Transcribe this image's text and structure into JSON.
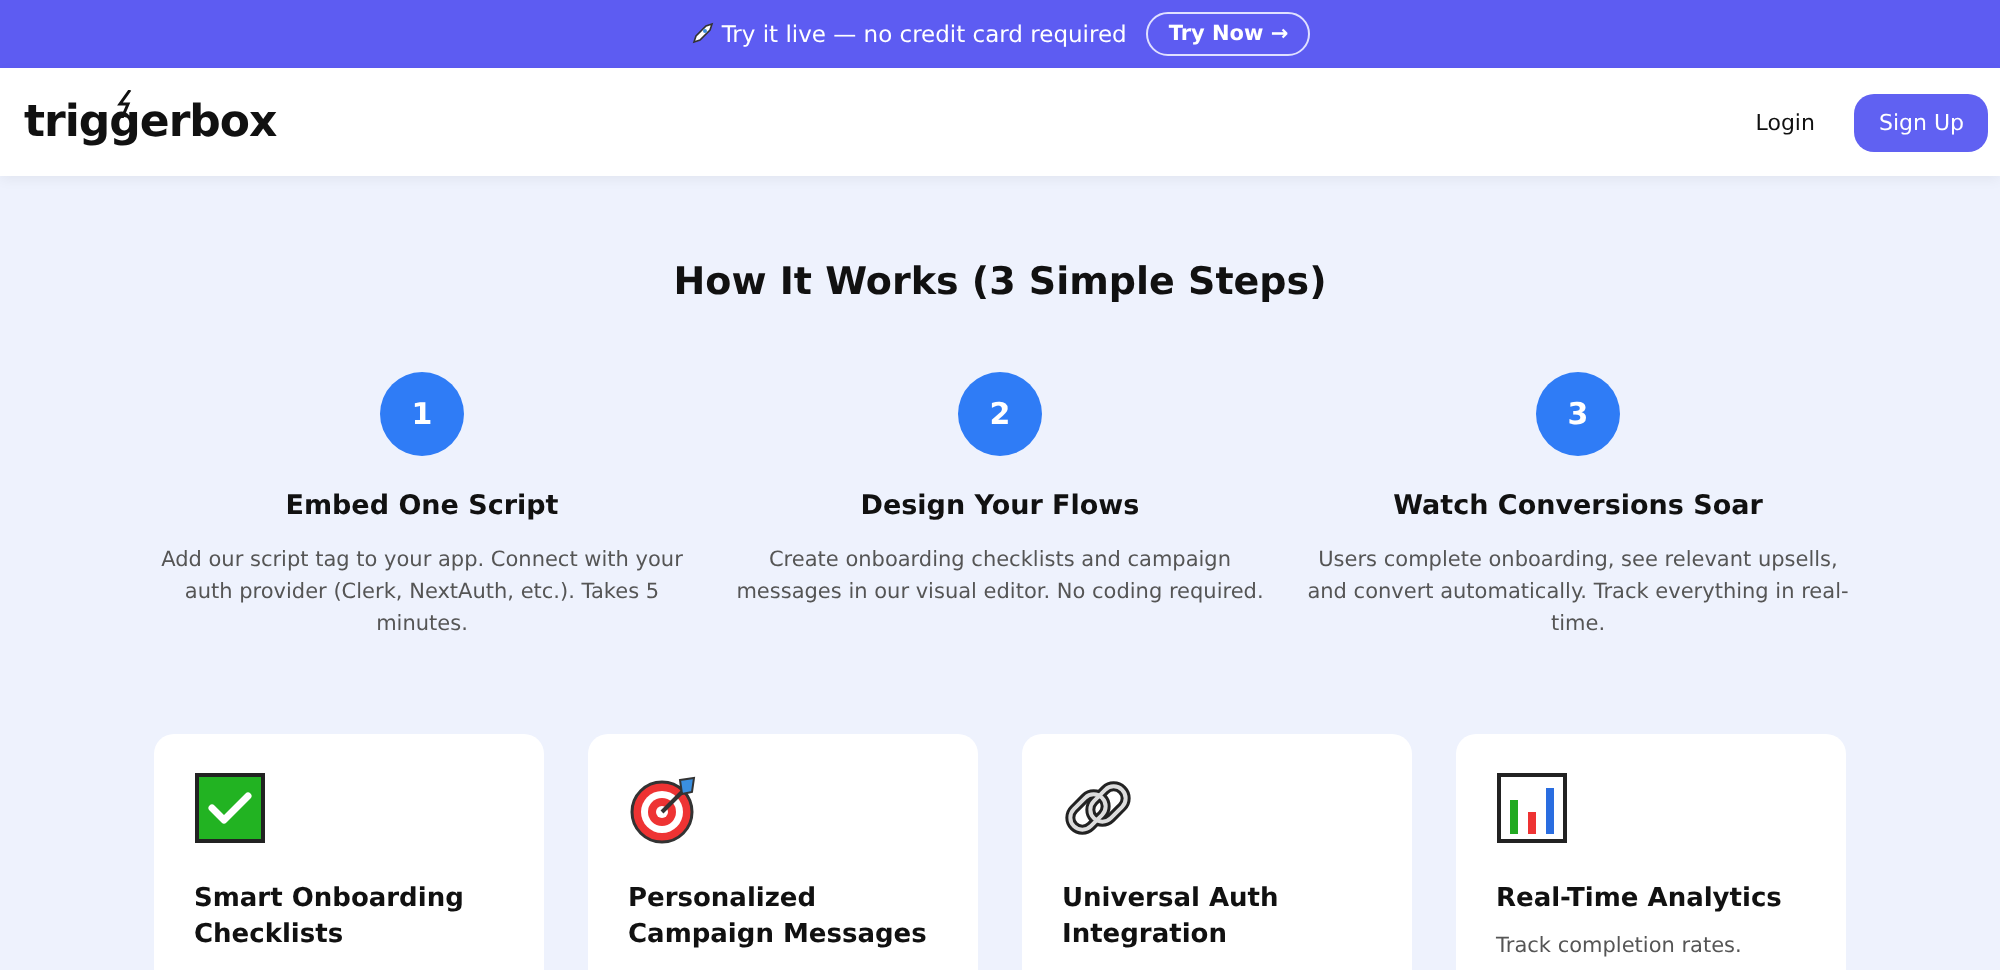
{
  "promo_banner": {
    "text": "Try it live — no credit card required",
    "button": "Try Now →"
  },
  "header": {
    "logo": "triggerbox",
    "login": "Login",
    "signup": "Sign Up"
  },
  "how_it_works": {
    "title": "How It Works (3 Simple Steps)",
    "steps": [
      {
        "number": "1",
        "title": "Embed One Script",
        "description": "Add our script tag to your app. Connect with your auth provider (Clerk, NextAuth, etc.). Takes 5 minutes."
      },
      {
        "number": "2",
        "title": "Design Your Flows",
        "description": "Create onboarding checklists and campaign messages in our visual editor. No coding required."
      },
      {
        "number": "3",
        "title": "Watch Conversions Soar",
        "description": "Users complete onboarding, see relevant upsells, and convert automatically. Track everything in real-time."
      }
    ]
  },
  "features": [
    {
      "title": "Smart Onboarding Checklists"
    },
    {
      "title": "Personalized Campaign Messages"
    },
    {
      "title": "Universal Auth Integration"
    },
    {
      "title": "Real-Time Analytics",
      "description": "Track completion rates."
    }
  ]
}
